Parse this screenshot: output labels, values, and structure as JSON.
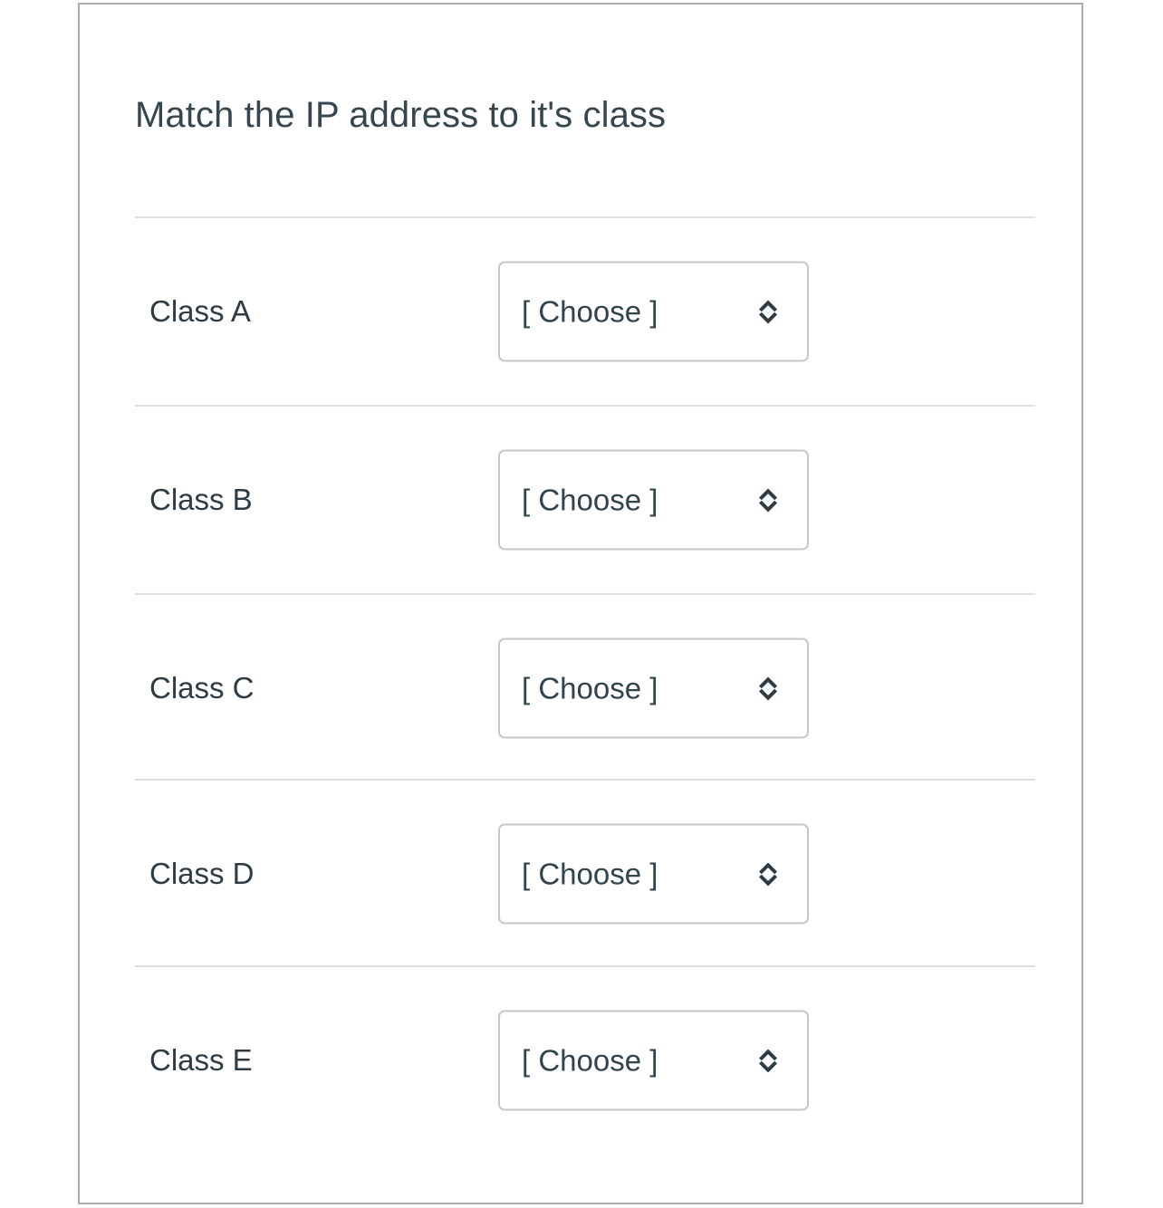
{
  "question": {
    "title": "Match the IP address to it's class",
    "rows": [
      {
        "label": "Class A",
        "select_value": "[ Choose ]",
        "arrow_icon": "chevron-up-down-icon"
      },
      {
        "label": "Class B",
        "select_value": "[ Choose ]",
        "arrow_icon": "chevron-up-down-icon"
      },
      {
        "label": "Class C",
        "select_value": "[ Choose ]",
        "arrow_icon": "chevron-up-down-icon"
      },
      {
        "label": "Class D",
        "select_value": "[ Choose ]",
        "arrow_icon": "chevron-up-down-icon"
      },
      {
        "label": "Class E",
        "select_value": "[ Choose ]",
        "arrow_icon": "chevron-up-down-icon"
      }
    ]
  },
  "colors": {
    "text_primary": "#2d3b45",
    "title": "#36464e",
    "card_border": "#adadad",
    "divider": "#dedede",
    "select_border": "#c7c7c7",
    "background": "#ffffff"
  }
}
